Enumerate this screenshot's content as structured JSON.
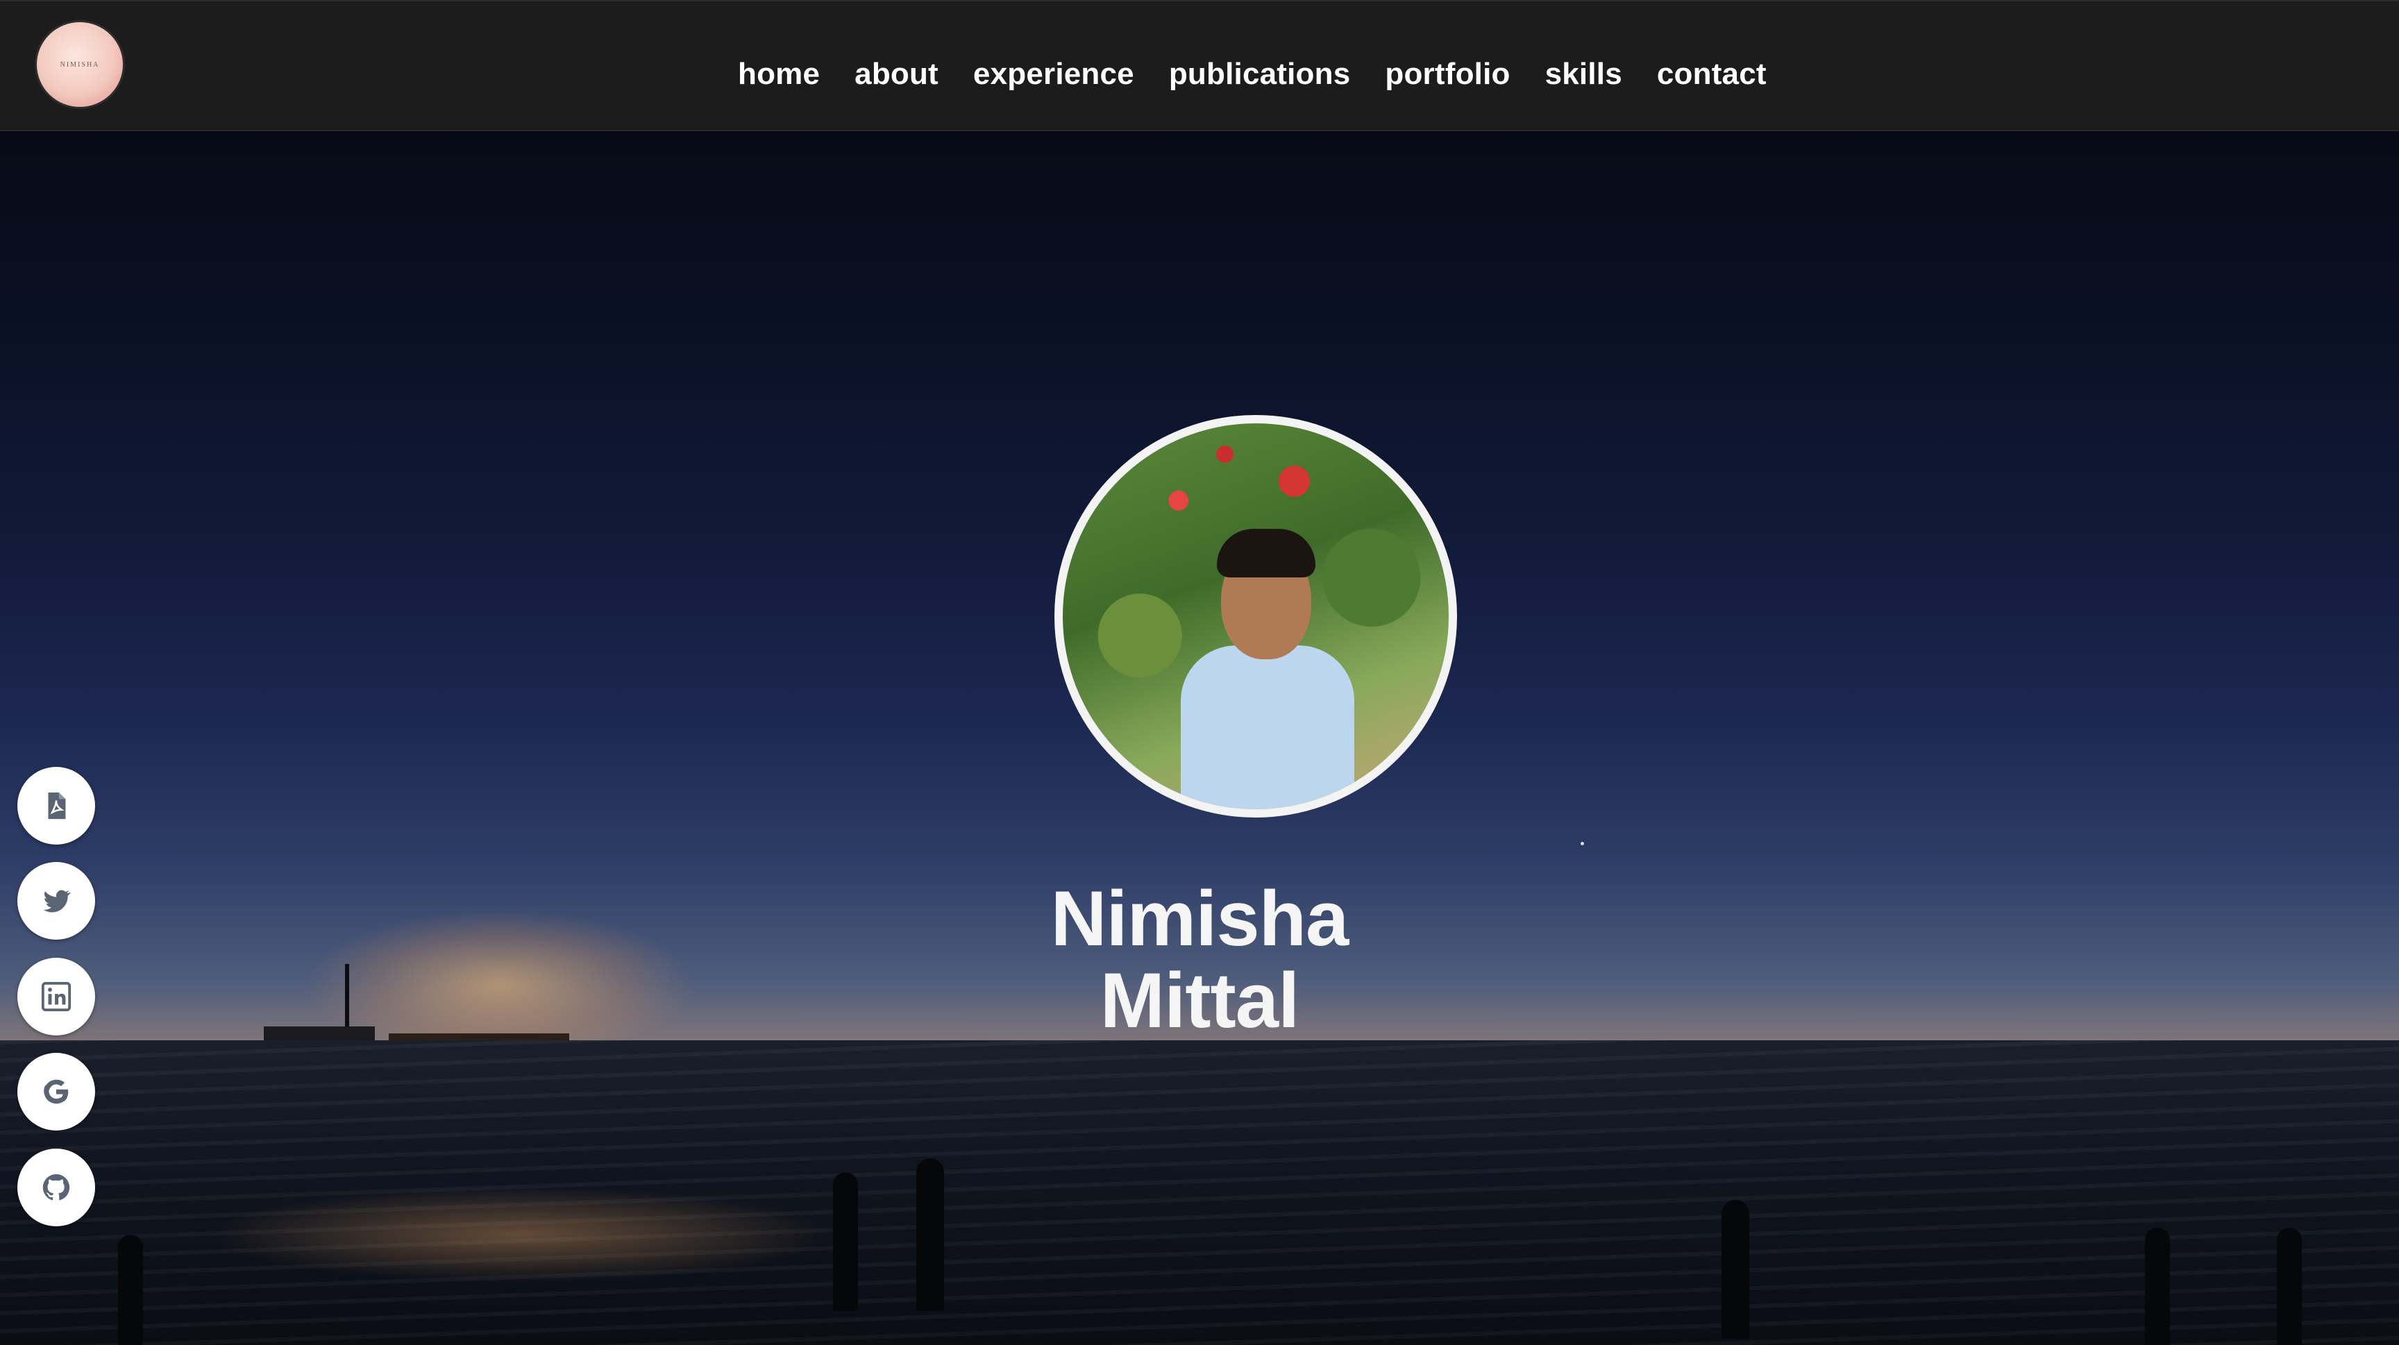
{
  "navbar": {
    "logo_text": "NIMISHA",
    "links": [
      {
        "label": "home"
      },
      {
        "label": "about"
      },
      {
        "label": "experience"
      },
      {
        "label": "publications"
      },
      {
        "label": "portfolio"
      },
      {
        "label": "skills"
      },
      {
        "label": "contact"
      }
    ]
  },
  "hero": {
    "first_name": "Nimisha",
    "last_name": "Mittal"
  },
  "social": [
    {
      "icon": "pdf-resume-icon"
    },
    {
      "icon": "twitter-icon"
    },
    {
      "icon": "linkedin-icon"
    },
    {
      "icon": "google-scholar-icon"
    },
    {
      "icon": "github-icon"
    }
  ],
  "colors": {
    "navbar_bg": "#1c1c1c",
    "nav_text": "#ffffff",
    "name_text": "#f5f5f5",
    "social_bg": "#ffffff",
    "social_icon": "#5a6472"
  }
}
